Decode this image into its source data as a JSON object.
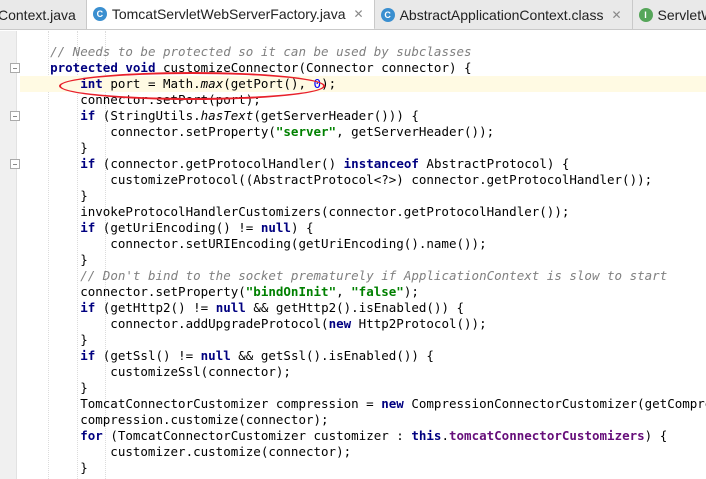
{
  "tabs": [
    {
      "label": "Context.java",
      "icon": "class",
      "color": "#3a8fd0",
      "closable": false,
      "active": false
    },
    {
      "label": "TomcatServletWebServerFactory.java",
      "icon": "class",
      "color": "#3a8fd0",
      "closable": true,
      "active": true
    },
    {
      "label": "AbstractApplicationContext.class",
      "icon": "class",
      "color": "#3a8fd0",
      "closable": true,
      "active": false
    },
    {
      "label": "ServletWebServ",
      "icon": "interface",
      "color": "#56a65a",
      "closable": false,
      "active": false
    }
  ],
  "close_glyph": "✕",
  "code_lines": [
    [
      {
        "t": "    "
      },
      {
        "t": "// Needs to be protected so it can be used by subclasses",
        "c": "cmt"
      }
    ],
    [
      {
        "t": "    "
      },
      {
        "t": "protected void",
        "c": "kw"
      },
      {
        "t": " customizeConnector(Connector connector) {"
      }
    ],
    [
      {
        "t": "        "
      },
      {
        "t": "int",
        "c": "kw"
      },
      {
        "t": " port = Math."
      },
      {
        "t": "max",
        "c": "it"
      },
      {
        "t": "(getPort(), "
      },
      {
        "t": "0",
        "c": "num"
      },
      {
        "t": ");"
      }
    ],
    [
      {
        "t": "        connector.setPort(port);"
      }
    ],
    [
      {
        "t": "        "
      },
      {
        "t": "if",
        "c": "kw"
      },
      {
        "t": " (StringUtils."
      },
      {
        "t": "hasText",
        "c": "it"
      },
      {
        "t": "(getServerHeader())) {"
      }
    ],
    [
      {
        "t": "            connector.setProperty("
      },
      {
        "t": "\"server\"",
        "c": "str"
      },
      {
        "t": ", getServerHeader());"
      }
    ],
    [
      {
        "t": "        }"
      }
    ],
    [
      {
        "t": "        "
      },
      {
        "t": "if",
        "c": "kw"
      },
      {
        "t": " (connector.getProtocolHandler() "
      },
      {
        "t": "instanceof",
        "c": "kw"
      },
      {
        "t": " AbstractProtocol) {"
      }
    ],
    [
      {
        "t": "            customizeProtocol((AbstractProtocol<?>) connector.getProtocolHandler());"
      }
    ],
    [
      {
        "t": "        }"
      }
    ],
    [
      {
        "t": "        invokeProtocolHandlerCustomizers(connector.getProtocolHandler());"
      }
    ],
    [
      {
        "t": "        "
      },
      {
        "t": "if",
        "c": "kw"
      },
      {
        "t": " (getUriEncoding() != "
      },
      {
        "t": "null",
        "c": "kw"
      },
      {
        "t": ") {"
      }
    ],
    [
      {
        "t": "            connector.setURIEncoding(getUriEncoding().name());"
      }
    ],
    [
      {
        "t": "        }"
      }
    ],
    [
      {
        "t": "        "
      },
      {
        "t": "// Don't bind to the socket prematurely if ApplicationContext is slow to start",
        "c": "cmt"
      }
    ],
    [
      {
        "t": "        connector.setProperty("
      },
      {
        "t": "\"bindOnInit\"",
        "c": "str"
      },
      {
        "t": ", "
      },
      {
        "t": "\"false\"",
        "c": "str"
      },
      {
        "t": ");"
      }
    ],
    [
      {
        "t": "        "
      },
      {
        "t": "if",
        "c": "kw"
      },
      {
        "t": " (getHttp2() != "
      },
      {
        "t": "null",
        "c": "kw"
      },
      {
        "t": " && getHttp2().isEnabled()) {"
      }
    ],
    [
      {
        "t": "            connector.addUpgradeProtocol("
      },
      {
        "t": "new",
        "c": "kw"
      },
      {
        "t": " Http2Protocol());"
      }
    ],
    [
      {
        "t": "        }"
      }
    ],
    [
      {
        "t": "        "
      },
      {
        "t": "if",
        "c": "kw"
      },
      {
        "t": " (getSsl() != "
      },
      {
        "t": "null",
        "c": "kw"
      },
      {
        "t": " && getSsl().isEnabled()) {"
      }
    ],
    [
      {
        "t": "            customizeSsl(connector);"
      }
    ],
    [
      {
        "t": "        }"
      }
    ],
    [
      {
        "t": "        TomcatConnectorCustomizer compression = "
      },
      {
        "t": "new",
        "c": "kw"
      },
      {
        "t": " CompressionConnectorCustomizer(getCompression("
      }
    ],
    [
      {
        "t": "        compression.customize(connector);"
      }
    ],
    [
      {
        "t": "        "
      },
      {
        "t": "for",
        "c": "kw"
      },
      {
        "t": " (TomcatConnectorCustomizer customizer : "
      },
      {
        "t": "this",
        "c": "kw"
      },
      {
        "t": "."
      },
      {
        "t": "tomcatConnectorCustomizers",
        "c": "fld"
      },
      {
        "t": ") {"
      }
    ],
    [
      {
        "t": "            customizer.customize(connector);"
      }
    ],
    [
      {
        "t": "        }"
      }
    ]
  ]
}
